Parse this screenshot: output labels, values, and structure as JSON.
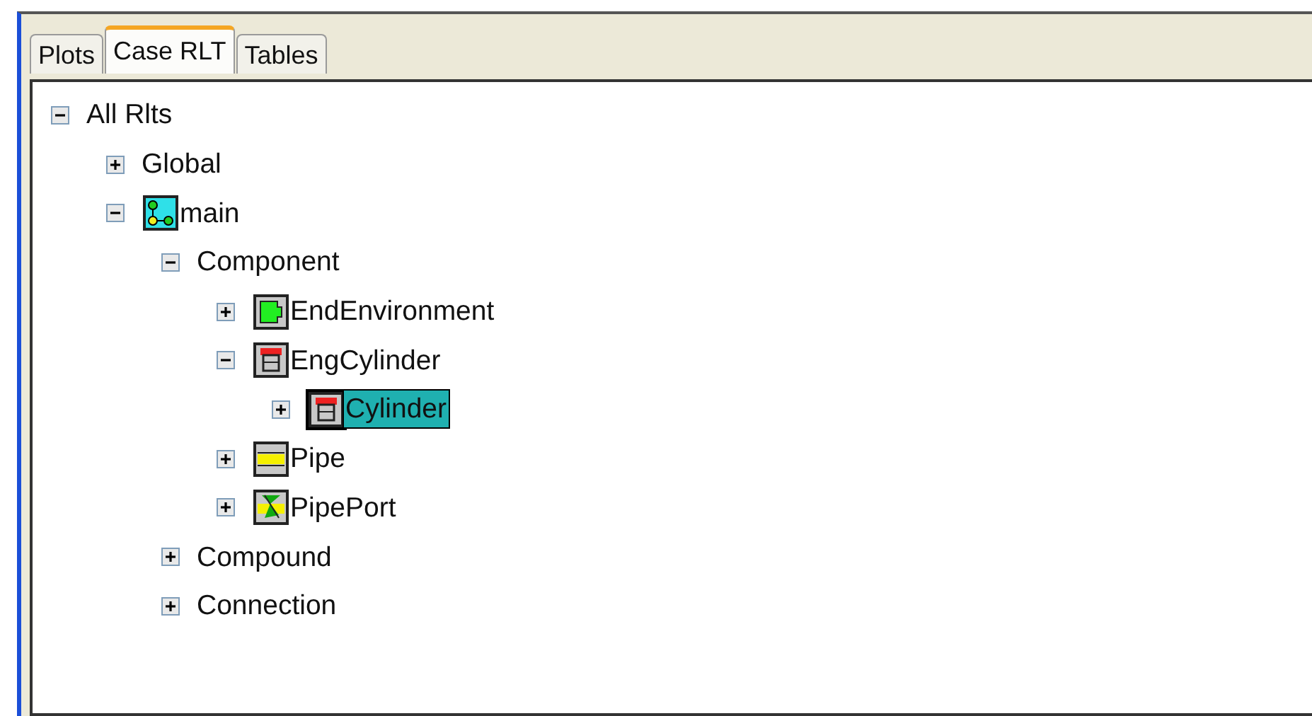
{
  "tabs": [
    {
      "label": "Plots",
      "selected": false
    },
    {
      "label": "Case RLT",
      "selected": true
    },
    {
      "label": "Tables",
      "selected": false
    }
  ],
  "tree": [
    {
      "label": "All Rlts",
      "expanded": true,
      "selected": false,
      "children": [
        {
          "label": "Global",
          "expanded": false,
          "selected": false
        },
        {
          "label": "main",
          "kind": "network",
          "expanded": true,
          "selected": false,
          "children": [
            {
              "label": "Component",
              "expanded": true,
              "selected": false,
              "children": [
                {
                  "label": "EndEnvironment",
                  "kind": "environment",
                  "expanded": false,
                  "selected": false
                },
                {
                  "label": "EngCylinder",
                  "kind": "cylinder",
                  "expanded": true,
                  "selected": false,
                  "children": [
                    {
                      "label": "Cylinder",
                      "kind": "cylinder",
                      "expanded": false,
                      "selected": true
                    }
                  ]
                },
                {
                  "label": "Pipe",
                  "kind": "pipe",
                  "expanded": false,
                  "selected": false
                },
                {
                  "label": "PipePort",
                  "kind": "port",
                  "expanded": false,
                  "selected": false
                }
              ]
            },
            {
              "label": "Compound",
              "expanded": false,
              "selected": false
            },
            {
              "label": "Connection",
              "expanded": false,
              "selected": false
            }
          ]
        }
      ]
    }
  ]
}
